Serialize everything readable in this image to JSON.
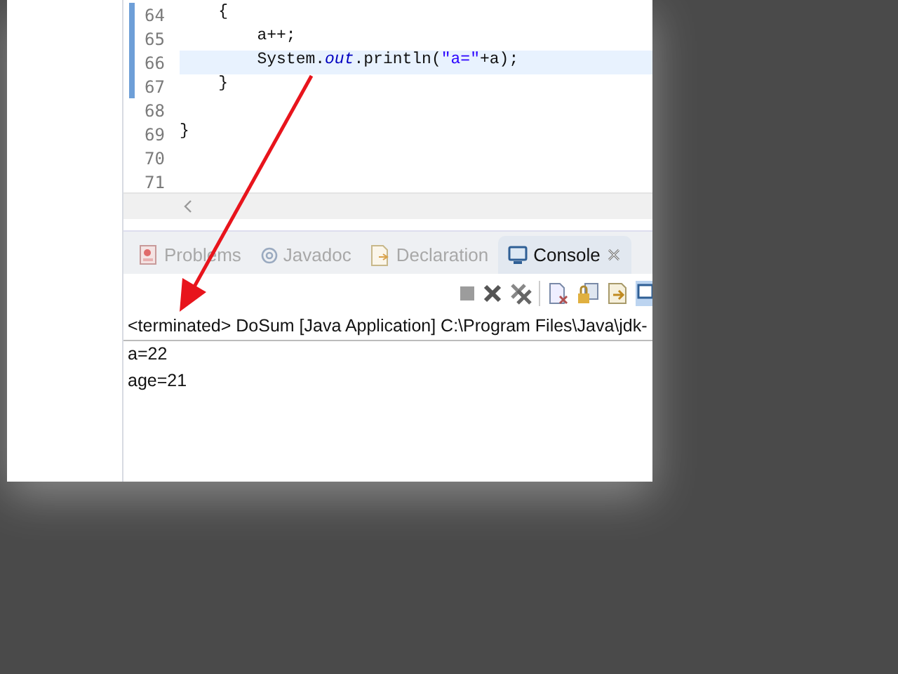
{
  "editor": {
    "lines": [
      {
        "number": "64",
        "current": false,
        "changed": true,
        "segments": [
          {
            "kind": "plain",
            "text": "    {"
          }
        ]
      },
      {
        "number": "65",
        "current": false,
        "changed": true,
        "segments": [
          {
            "kind": "plain",
            "text": "        a++;"
          }
        ]
      },
      {
        "number": "66",
        "current": true,
        "changed": true,
        "segments": [
          {
            "kind": "plain",
            "text": "        System."
          },
          {
            "kind": "field",
            "text": "out"
          },
          {
            "kind": "plain",
            "text": ".println("
          },
          {
            "kind": "string",
            "text": "\"a=\""
          },
          {
            "kind": "plain",
            "text": "+a);"
          }
        ]
      },
      {
        "number": "67",
        "current": false,
        "changed": true,
        "segments": [
          {
            "kind": "plain",
            "text": "    }"
          }
        ]
      },
      {
        "number": "68",
        "current": false,
        "changed": false
      },
      {
        "number": "69",
        "current": false,
        "changed": false,
        "segments": [
          {
            "kind": "plain",
            "text": "}"
          }
        ]
      },
      {
        "number": "70",
        "current": false,
        "changed": false
      },
      {
        "number": "71",
        "current": false,
        "changed": false
      }
    ]
  },
  "views": {
    "tabs": [
      {
        "kind": "problems",
        "label": "Problems",
        "selected": false
      },
      {
        "kind": "javadoc",
        "label": "Javadoc",
        "selected": false
      },
      {
        "kind": "declaration",
        "label": "Declaration",
        "selected": false
      },
      {
        "kind": "console",
        "label": "Console",
        "selected": true
      }
    ]
  },
  "console": {
    "header": "<terminated> DoSum [Java Application] C:\\Program Files\\Java\\jdk-",
    "output": [
      "a=22",
      "age=21"
    ]
  }
}
